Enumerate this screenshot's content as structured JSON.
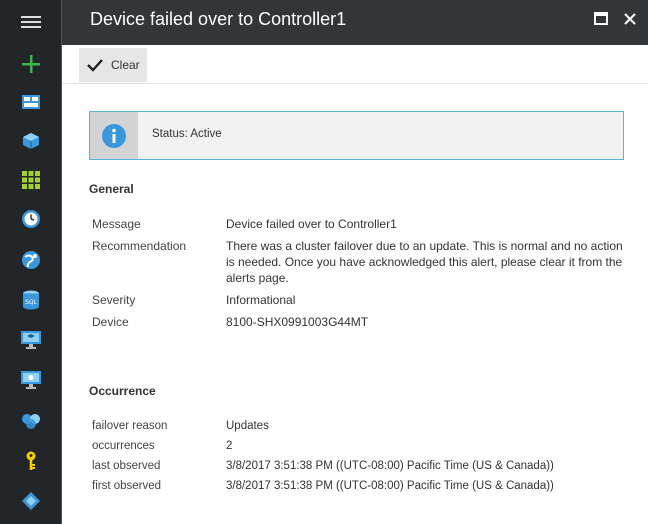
{
  "window": {
    "title": "Device failed over to Controller1"
  },
  "sidebar": {
    "items": [
      {
        "icon": "hamburger-menu-icon"
      },
      {
        "icon": "plus-icon",
        "color": "#3cb44b"
      },
      {
        "icon": "dashboard-icon"
      },
      {
        "icon": "cube-icon"
      },
      {
        "icon": "grid-icon",
        "color": "#a6ce39"
      },
      {
        "icon": "clock-icon"
      },
      {
        "icon": "globe-icon"
      },
      {
        "icon": "sql-database-icon"
      },
      {
        "icon": "monitor-icon"
      },
      {
        "icon": "virtual-machine-icon"
      },
      {
        "icon": "network-icon"
      },
      {
        "icon": "key-icon",
        "color": "#f5d000"
      },
      {
        "icon": "diamond-icon"
      }
    ]
  },
  "toolbar": {
    "clear_label": "Clear"
  },
  "status": {
    "text": "Status: Active",
    "icon": "info-icon"
  },
  "general": {
    "heading": "General",
    "rows": [
      {
        "key": "Message",
        "value": "Device failed over to Controller1"
      },
      {
        "key": "Recommendation",
        "value": "There was a cluster failover due to an update. This is normal and no action is needed. Once you have acknowledged this alert, please clear it from the alerts page."
      },
      {
        "key": "Severity",
        "value": "Informational"
      },
      {
        "key": "Device",
        "value": "8100-SHX0991003G44MT"
      }
    ]
  },
  "occurrence": {
    "heading": "Occurrence",
    "rows": [
      {
        "key": "failover reason",
        "value": "Updates"
      },
      {
        "key": "occurrences",
        "value": "2"
      },
      {
        "key": "last observed",
        "value": "3/8/2017 3:51:38 PM ((UTC-08:00) Pacific Time (US & Canada))"
      },
      {
        "key": "first observed",
        "value": "3/8/2017 3:51:38 PM ((UTC-08:00) Pacific Time (US & Canada))"
      }
    ]
  },
  "colors": {
    "sidebar_bg": "#222629",
    "header_bg": "#333638",
    "status_border": "#58b1dd"
  }
}
